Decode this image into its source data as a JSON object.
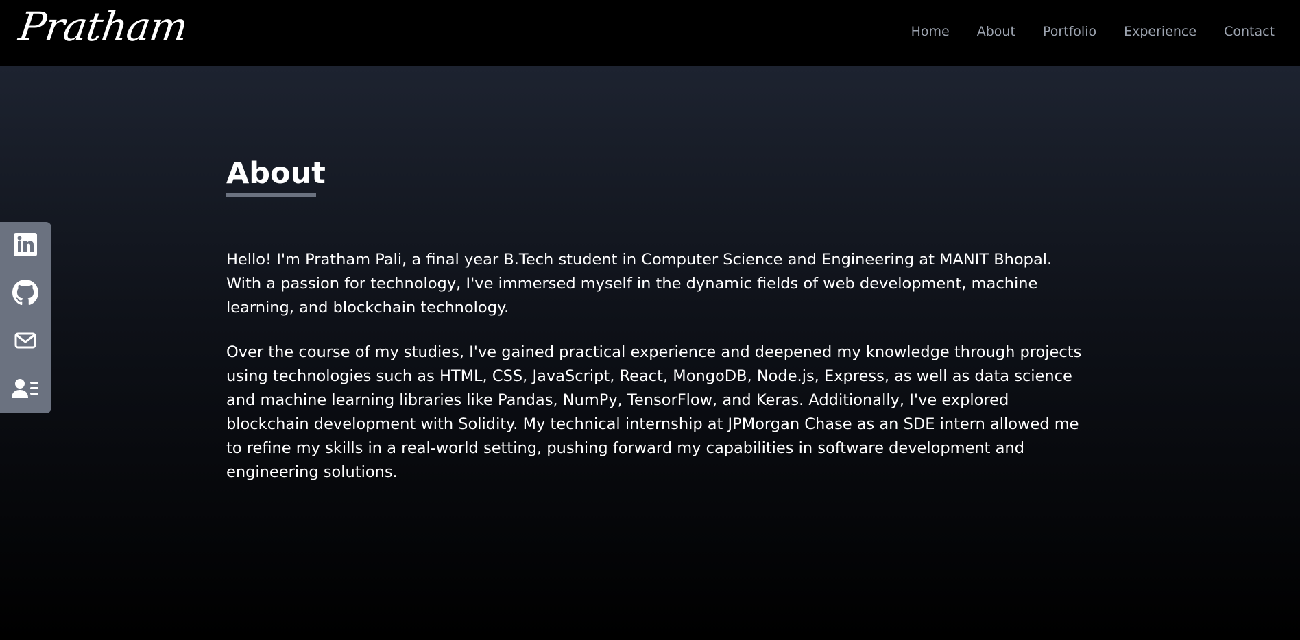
{
  "header": {
    "logo": "Pratham",
    "nav": [
      "Home",
      "About",
      "Portfolio",
      "Experience",
      "Contact"
    ]
  },
  "about": {
    "title": "About",
    "paragraphs": [
      "Hello! I'm Pratham Pali, a final year B.Tech student in Computer Science and Engineering at MANIT Bhopal. With a passion for technology, I've immersed myself in the dynamic fields of web development, machine learning, and blockchain technology.",
      "Over the course of my studies, I've gained practical experience and deepened my knowledge through projects using technologies such as HTML, CSS, JavaScript, React, MongoDB, Node.js, Express, as well as data science and machine learning libraries like Pandas, NumPy, TensorFlow, and Keras. Additionally, I've explored blockchain development with Solidity. My technical internship at JPMorgan Chase as an SDE intern allowed me to refine my skills in a real-world setting, pushing forward my capabilities in software development and engineering solutions."
    ]
  },
  "social": {
    "icons": [
      "linkedin-icon",
      "github-icon",
      "mail-icon",
      "resume-icon"
    ]
  },
  "colors": {
    "navbar_bg": "#000000",
    "nav_link": "#9ca3af",
    "social_bar_bg": "#6b7280",
    "underline": "#6b7280",
    "gradient_top": "#1d2330",
    "gradient_bottom": "#000000"
  }
}
